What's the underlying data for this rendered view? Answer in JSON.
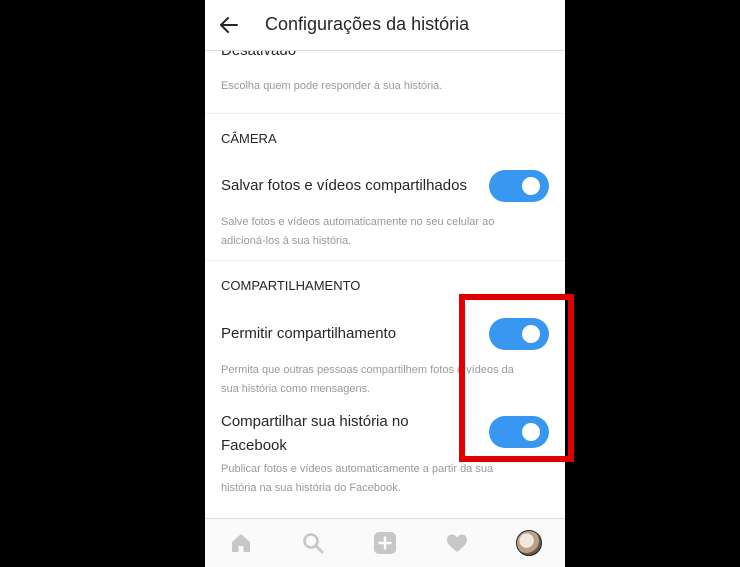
{
  "header": {
    "title": "Configurações da história"
  },
  "replies": {
    "value": "Desativado",
    "description": "Escolha quem pode responder à sua história."
  },
  "camera": {
    "section_title": "CÂMERA",
    "save": {
      "label": "Salvar fotos e vídeos compartilhados",
      "enabled": true,
      "description_line1": "Salve fotos e vídeos automaticamente no seu celular ao",
      "description_line2": "adicioná-los à sua história."
    }
  },
  "sharing": {
    "section_title": "COMPARTILHAMENTO",
    "allow": {
      "label": "Permitir compartilhamento",
      "enabled": true,
      "description_line1": "Permita que outras pessoas compartilhem fotos e vídeos da",
      "description_line2": "sua história como mensagens."
    },
    "facebook": {
      "label_line1": "Compartilhar sua história no",
      "label_line2": "Facebook",
      "enabled": true,
      "description_line1": "Publicar fotos e vídeos automaticamente a partir da sua",
      "description_line2": "história na sua história do Facebook."
    }
  },
  "colors": {
    "toggle_on": "#3897f0",
    "highlight": "#e00000"
  },
  "tabbar": {
    "icons": [
      "home-icon",
      "search-icon",
      "add-icon",
      "heart-icon",
      "profile-avatar"
    ]
  }
}
